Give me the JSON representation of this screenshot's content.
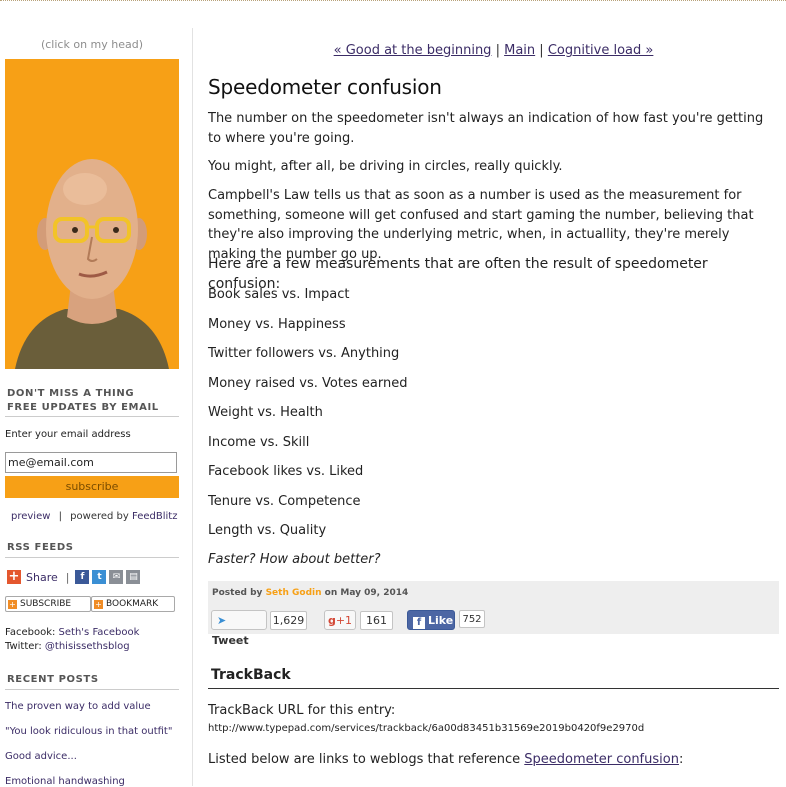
{
  "sidebar": {
    "click_head": "(click on my head)",
    "email_heading": "DON'T MISS A THING\nFREE UPDATES BY EMAIL",
    "email_heading_line1": "DON'T MISS A THING",
    "email_heading_line2": "FREE UPDATES BY EMAIL",
    "email_label": "Enter your email address",
    "email_value": "me@email.com",
    "subscribe_label": "subscribe",
    "preview_link": "preview",
    "powered_by": "powered by",
    "feedblitz_link": "FeedBlitz",
    "rss_heading": "RSS FEEDS",
    "share_label": "Share",
    "share_separator": "|",
    "subscribe_pill": "SUBSCRIBE",
    "bookmark_pill": "BOOKMARK",
    "facebook_prefix": "Facebook:",
    "facebook_link": "Seth's Facebook",
    "twitter_prefix": "Twitter:",
    "twitter_link": "@thisissethsblog",
    "recent_heading": "RECENT POSTS",
    "recent_posts": [
      "The proven way to add value",
      "\"You look ridiculous in that outfit\"",
      "Good advice...",
      "Emotional handwashing"
    ]
  },
  "nav": {
    "prev": "« Good at the beginning",
    "sep1": "|",
    "main": "Main",
    "sep2": "|",
    "next": "Cognitive load »"
  },
  "post": {
    "title": "Speedometer confusion",
    "paragraphs": [
      "The number on the speedometer isn't always an indication of how fast you're getting to where you're going.",
      "You might, after all, be driving in circles, really quickly.",
      "Campbell's Law tells us that as soon as a number is used as the measurement for something, someone will get confused and start gaming the number, believing that they're also improving the underlying metric, when, in actuallity, they're merely making the number go up.",
      "Here are a few measurements that are often the result of speedometer confusion:"
    ],
    "list": [
      "Book sales vs. Impact",
      "Money vs. Happiness",
      "Twitter followers vs. Anything",
      "Money raised vs. Votes earned",
      "Weight vs. Health",
      "Income vs. Skill",
      "Facebook likes vs. Liked",
      "Tenure vs. Competence",
      "Length vs. Quality"
    ],
    "closing": "Faster? How about better?",
    "posted_by": "Posted by",
    "author": "Seth Godin",
    "posted_on": "on May 09, 2014",
    "tweet_label": "Tweet",
    "tweet_count": "1,629",
    "gplus_label": "+1",
    "gplus_count": "161",
    "like_label": "Like",
    "like_count": "752"
  },
  "trackback": {
    "heading": "TrackBack",
    "url_label": "TrackBack URL for this entry:",
    "url": "http://www.typepad.com/services/trackback/6a00d83451b31569e2019b0420f9e2970d",
    "listed_below": "Listed below are links to weblogs that reference",
    "post_link": "Speedometer confusion",
    "colon": ":"
  },
  "colors": {
    "accent_orange": "#f7a016",
    "link_purple": "#3b2c66",
    "twitter_blue": "#3a8fd4",
    "facebook_blue": "#3b5998",
    "gplus_red": "#d34836"
  }
}
